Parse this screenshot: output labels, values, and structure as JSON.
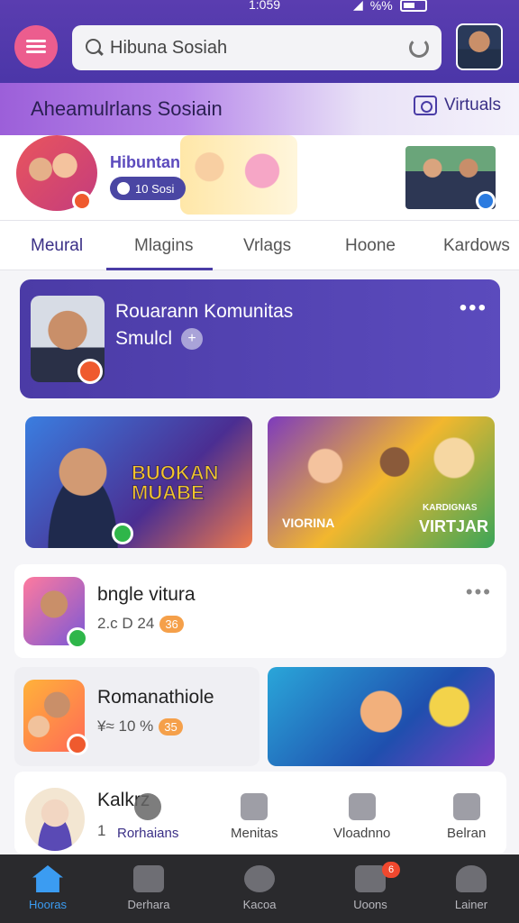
{
  "status": {
    "time": "1:059",
    "battery": "%%"
  },
  "header": {
    "search_value": "Hibuna Sosiah",
    "title": "Aheamulrlans Sosiain",
    "virtual_label": "Virtuals"
  },
  "stories": {
    "label": "Hibuntan",
    "chip": "10 Sosi"
  },
  "tabs": [
    "Meural",
    "Mlagins",
    "Vrlags",
    "Hoone",
    "Kardows"
  ],
  "community": {
    "title": "Rouarann Komunitas",
    "subtitle": "Smulcl"
  },
  "banners": {
    "b1_title": "BUOKAN MUABE",
    "b2_sub": "VIORINA",
    "b2_small": "KARDIGNAS",
    "b2_title": "VIRTJAR"
  },
  "posts": [
    {
      "name": "bngle vitura",
      "meta": "2.c D 24",
      "chip": "36"
    },
    {
      "name": "Romanathiole",
      "meta": "¥≈ 10 %",
      "chip": "35"
    },
    {
      "name": "Kalkrz",
      "meta": "1"
    }
  ],
  "shortcuts": [
    "Rorhaians",
    "Menitas",
    "Vloadnno",
    "Belran"
  ],
  "bottom_nav": [
    {
      "label": "Hooras",
      "active": true
    },
    {
      "label": "Derhara"
    },
    {
      "label": "Kacoa"
    },
    {
      "label": "Uoons",
      "badge": "6"
    },
    {
      "label": "Lainer"
    }
  ]
}
